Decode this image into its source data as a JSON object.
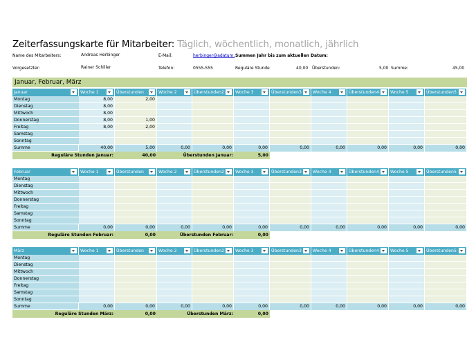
{
  "title": {
    "main": "Zeiterfassungskarte für Mitarbeiter:",
    "sub": "Täglich, wöchentlich, monatlich, jährlich"
  },
  "info": {
    "name_label": "Name des Mitarbeiters:",
    "name_value": "Andreas Herbinger",
    "supervisor_label": "Vorgesetzter:",
    "supervisor_value": "Rainer Schiller",
    "email_label": "E-Mail:",
    "email_value": "herbinger@adatum.",
    "phone_label": "Telefon:",
    "phone_value": "0555-555",
    "ytd_label": "Summen Jahr bis zum aktuellen Datum:",
    "regular_label": "Reguläre Stunde",
    "regular_value": "40,00",
    "overtime_label": "Überstunden:",
    "overtime_value": "5,00",
    "sum_label": "Summe:",
    "sum_value": "45,00"
  },
  "section_title": "Januar, Februar, März",
  "columns": [
    "Woche 1",
    "Überstunden",
    "Woche 2",
    "Überstunden2",
    "Woche 3",
    "Überstunden3",
    "Woche 4",
    "Überstunden4",
    "Woche 5",
    "Überstunden5"
  ],
  "days": [
    "Montag",
    "Dienstag",
    "Mittwoch",
    "Donnerstag",
    "Freitag",
    "Samstag",
    "Sonntag"
  ],
  "sum_label": "Summe",
  "months": [
    {
      "name": "Januar",
      "values": [
        [
          "8,00",
          "2,00",
          "",
          "",
          "",
          "",
          "",
          "",
          "",
          ""
        ],
        [
          "8,00",
          "",
          "",
          "",
          "",
          "",
          "",
          "",
          "",
          ""
        ],
        [
          "8,00",
          "",
          "",
          "",
          "",
          "",
          "",
          "",
          "",
          ""
        ],
        [
          "8,00",
          "1,00",
          "",
          "",
          "",
          "",
          "",
          "",
          "",
          ""
        ],
        [
          "8,00",
          "2,00",
          "",
          "",
          "",
          "",
          "",
          "",
          "",
          ""
        ],
        [
          "",
          "",
          "",
          "",
          "",
          "",
          "",
          "",
          "",
          ""
        ],
        [
          "",
          "",
          "",
          "",
          "",
          "",
          "",
          "",
          "",
          ""
        ]
      ],
      "sums": [
        "40,00",
        "5,00",
        "0,00",
        "0,00",
        "0,00",
        "0,00",
        "0,00",
        "0,00",
        "0,00",
        "0,00"
      ],
      "regular_label": "Reguläre Stunden Januar:",
      "regular_value": "40,00",
      "overtime_label": "Überstunden Januar:",
      "overtime_value": "5,00"
    },
    {
      "name": "Februar",
      "values": [
        [
          "",
          "",
          "",
          "",
          "",
          "",
          "",
          "",
          "",
          ""
        ],
        [
          "",
          "",
          "",
          "",
          "",
          "",
          "",
          "",
          "",
          ""
        ],
        [
          "",
          "",
          "",
          "",
          "",
          "",
          "",
          "",
          "",
          ""
        ],
        [
          "",
          "",
          "",
          "",
          "",
          "",
          "",
          "",
          "",
          ""
        ],
        [
          "",
          "",
          "",
          "",
          "",
          "",
          "",
          "",
          "",
          ""
        ],
        [
          "",
          "",
          "",
          "",
          "",
          "",
          "",
          "",
          "",
          ""
        ],
        [
          "",
          "",
          "",
          "",
          "",
          "",
          "",
          "",
          "",
          ""
        ]
      ],
      "sums": [
        "0,00",
        "0,00",
        "0,00",
        "0,00",
        "0,00",
        "0,00",
        "0,00",
        "0,00",
        "0,00",
        "0,00"
      ],
      "regular_label": "Reguläre Stunden Februar:",
      "regular_value": "0,00",
      "overtime_label": "Überstunden Februar:",
      "overtime_value": "0,00"
    },
    {
      "name": "März",
      "values": [
        [
          "",
          "",
          "",
          "",
          "",
          "",
          "",
          "",
          "",
          ""
        ],
        [
          "",
          "",
          "",
          "",
          "",
          "",
          "",
          "",
          "",
          ""
        ],
        [
          "",
          "",
          "",
          "",
          "",
          "",
          "",
          "",
          "",
          ""
        ],
        [
          "",
          "",
          "",
          "",
          "",
          "",
          "",
          "",
          "",
          ""
        ],
        [
          "",
          "",
          "",
          "",
          "",
          "",
          "",
          "",
          "",
          ""
        ],
        [
          "",
          "",
          "",
          "",
          "",
          "",
          "",
          "",
          "",
          ""
        ],
        [
          "",
          "",
          "",
          "",
          "",
          "",
          "",
          "",
          "",
          ""
        ]
      ],
      "sums": [
        "0,00",
        "0,00",
        "0,00",
        "0,00",
        "0,00",
        "0,00",
        "0,00",
        "0,00",
        "0,00",
        "0,00"
      ],
      "regular_label": "Reguläre Stunden März:",
      "regular_value": "0,00",
      "overtime_label": "Überstunden März:",
      "overtime_value": "0,00"
    }
  ]
}
